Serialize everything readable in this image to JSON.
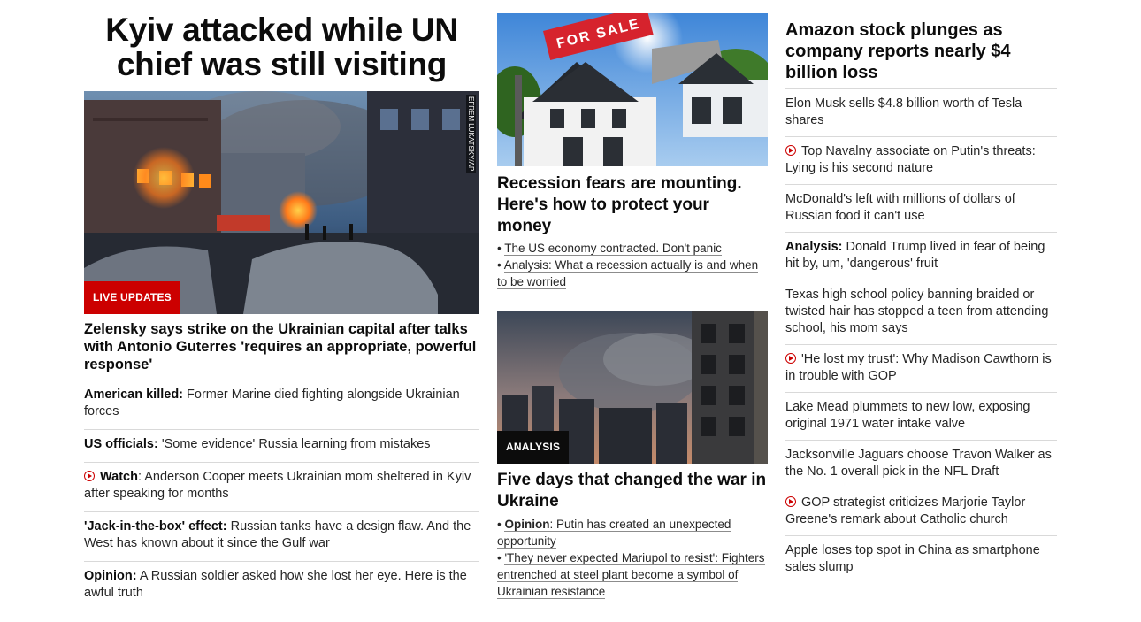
{
  "col1": {
    "headline": "Kyiv attacked while UN chief was still visiting",
    "hero_badge": "LIVE UPDATES",
    "hero_credit": "EFREM LUKATSKY/AP",
    "lead": "Zelensky says strike on the Ukrainian capital after talks with Antonio Guterres 'requires an appropriate, powerful response'",
    "items": [
      {
        "prefix": "American killed:",
        "text": " Former Marine died fighting alongside Ukrainian forces",
        "video": false
      },
      {
        "prefix": "US officials:",
        "text": " 'Some evidence' Russia learning from mistakes",
        "video": false
      },
      {
        "prefix": "Watch",
        "text": ": Anderson Cooper meets Ukrainian mom sheltered in Kyiv after speaking for months",
        "video": true
      },
      {
        "prefix": "'Jack-in-the-box' effect:",
        "text": " Russian tanks have a design flaw. And the West has known about it since the Gulf war",
        "video": false
      },
      {
        "prefix": "Opinion:",
        "text": " A Russian soldier asked how she lost her eye. Here is the awful truth",
        "video": false
      }
    ]
  },
  "col2": {
    "story1": {
      "sign": "FOR SALE",
      "headline": "Recession fears are mounting. Here's how to protect your money",
      "bullets": [
        "The US economy contracted. Don't panic",
        "Analysis: What a recession actually is and when to be worried"
      ]
    },
    "story2": {
      "badge": "ANALYSIS",
      "headline": "Five days that changed the war in Ukraine",
      "bullets": [
        {
          "prefix": "Opinion",
          "text": ": Putin has created an unexpected opportunity"
        },
        {
          "prefix": "",
          "text": "'They never expected Mariupol to resist': Fighters entrenched at steel plant become a symbol of Ukrainian resistance"
        }
      ]
    }
  },
  "col3": {
    "headline": "Amazon stock plunges as company reports nearly $4 billion loss",
    "items": [
      {
        "prefix": "",
        "text": "Elon Musk sells $4.8 billion worth of Tesla shares",
        "video": false
      },
      {
        "prefix": "",
        "text": "Top Navalny associate on Putin's threats: Lying is his second nature",
        "video": true
      },
      {
        "prefix": "",
        "text": "McDonald's left with millions of dollars of Russian food it can't use",
        "video": false
      },
      {
        "prefix": "Analysis:",
        "text": " Donald Trump lived in fear of being hit by, um, 'dangerous' fruit",
        "video": false
      },
      {
        "prefix": "",
        "text": "Texas high school policy banning braided or twisted hair has stopped a teen from attending school, his mom says",
        "video": false
      },
      {
        "prefix": "",
        "text": "'He lost my trust': Why Madison Cawthorn is in trouble with GOP",
        "video": true
      },
      {
        "prefix": "",
        "text": "Lake Mead plummets to new low, exposing original 1971 water intake valve",
        "video": false
      },
      {
        "prefix": "",
        "text": "Jacksonville Jaguars choose Travon Walker as the No. 1 overall pick in the NFL Draft",
        "video": false
      },
      {
        "prefix": "",
        "text": "GOP strategist criticizes Marjorie Taylor Greene's remark about Catholic church",
        "video": true
      },
      {
        "prefix": "",
        "text": "Apple loses top spot in China as smartphone sales slump",
        "video": false
      }
    ]
  }
}
